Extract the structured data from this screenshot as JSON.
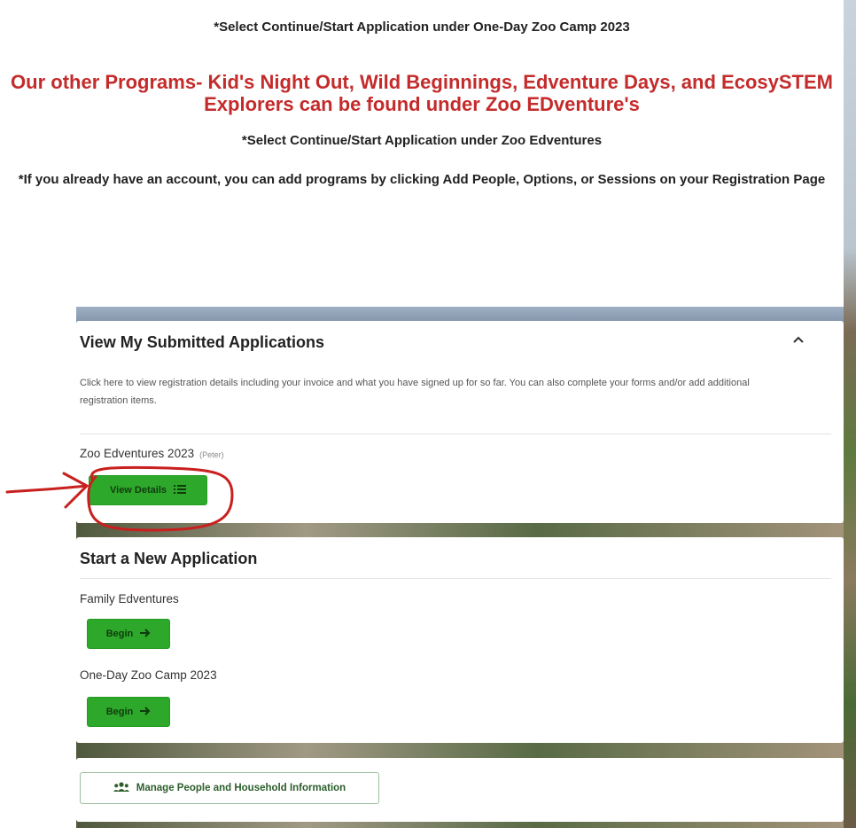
{
  "notices": {
    "camp_select": "*Select Continue/Start Application under One-Day Zoo Camp 2023",
    "other_programs": "Our other Programs- Kid's Night Out, Wild Beginnings, Edventure Days, and EcosySTEM Explorers can be found under Zoo EDventure's",
    "zoo_select": "*Select Continue/Start Application under Zoo Edventures",
    "existing_account": "*If you already have an account, you can add programs by clicking Add People, Options, or Sessions on your Registration Page"
  },
  "submitted": {
    "title": "View My Submitted Applications",
    "collapse_icon": "chevron-up-icon",
    "description": "Click here to view registration details including your invoice and what you have signed up for so far. You can also complete your forms and/or add additional registration items.",
    "application_name": "Zoo Edventures 2023",
    "application_person": "(Peter)",
    "view_details_label": "View Details",
    "view_details_icon": "list-icon"
  },
  "new_application": {
    "title": "Start a New Application",
    "programs": [
      {
        "name": "Family Edventures",
        "button_label": "Begin",
        "button_icon": "arrow-right-icon"
      },
      {
        "name": "One-Day Zoo Camp 2023",
        "button_label": "Begin",
        "button_icon": "arrow-right-icon"
      }
    ]
  },
  "manage": {
    "label": "Manage People and Household Information",
    "icon": "people-icon"
  },
  "colors": {
    "accent_green": "#2ea82a",
    "heading_red": "#c42b2b",
    "annotation_red": "#c8201e"
  }
}
